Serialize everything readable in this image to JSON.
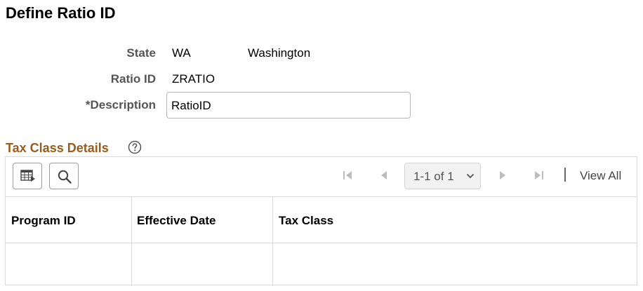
{
  "page": {
    "title": "Define Ratio ID"
  },
  "fields": {
    "state_label": "State",
    "state_code": "WA",
    "state_name": "Washington",
    "ratio_id_label": "Ratio ID",
    "ratio_id_value": "ZRATIO",
    "description_label": "*Description",
    "description_value": "RatioID"
  },
  "section": {
    "title": "Tax Class Details",
    "help_icon": "question-circle-icon"
  },
  "grid": {
    "toolbar": {
      "personalize_icon": "grid-personalize-icon",
      "find_icon": "search-icon",
      "pager_value": "1-1 of 1",
      "view_all": "View All"
    },
    "columns": [
      "Program ID",
      "Effective Date",
      "Tax Class"
    ],
    "rows": [
      [
        "",
        "",
        ""
      ]
    ]
  }
}
